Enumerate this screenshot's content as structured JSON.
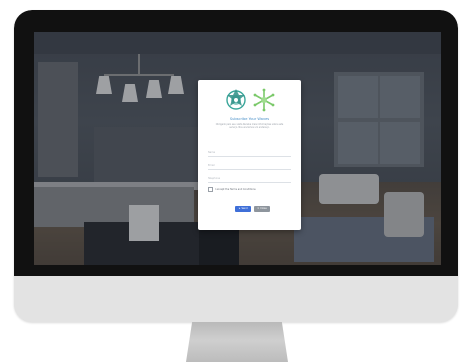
{
  "modal": {
    "title": "Subscribe Your Waves",
    "subtitle": "Obrigado pelo seu visita Receba mais informações sobre este serviço. Nos enviamos um endereço.",
    "fields": {
      "name_placeholder": "Name",
      "email_placeholder": "Email",
      "telephone_placeholder": "Telephone"
    },
    "checkbox_label": "I accept the Terms and Conditions",
    "buttons": {
      "send_label": "Send",
      "close_label": "Close"
    }
  },
  "icons": {
    "logo_left": "mandala-logo-teal",
    "logo_right": "snowflake-logo-green",
    "send_icon": "send-icon",
    "close_icon": "close-icon"
  },
  "colors": {
    "title_accent": "#4a90c8",
    "primary_button": "#3f6fd8",
    "secondary_button": "#8e959d",
    "logo_left": "#3aa69a",
    "logo_right": "#7bc96a"
  }
}
